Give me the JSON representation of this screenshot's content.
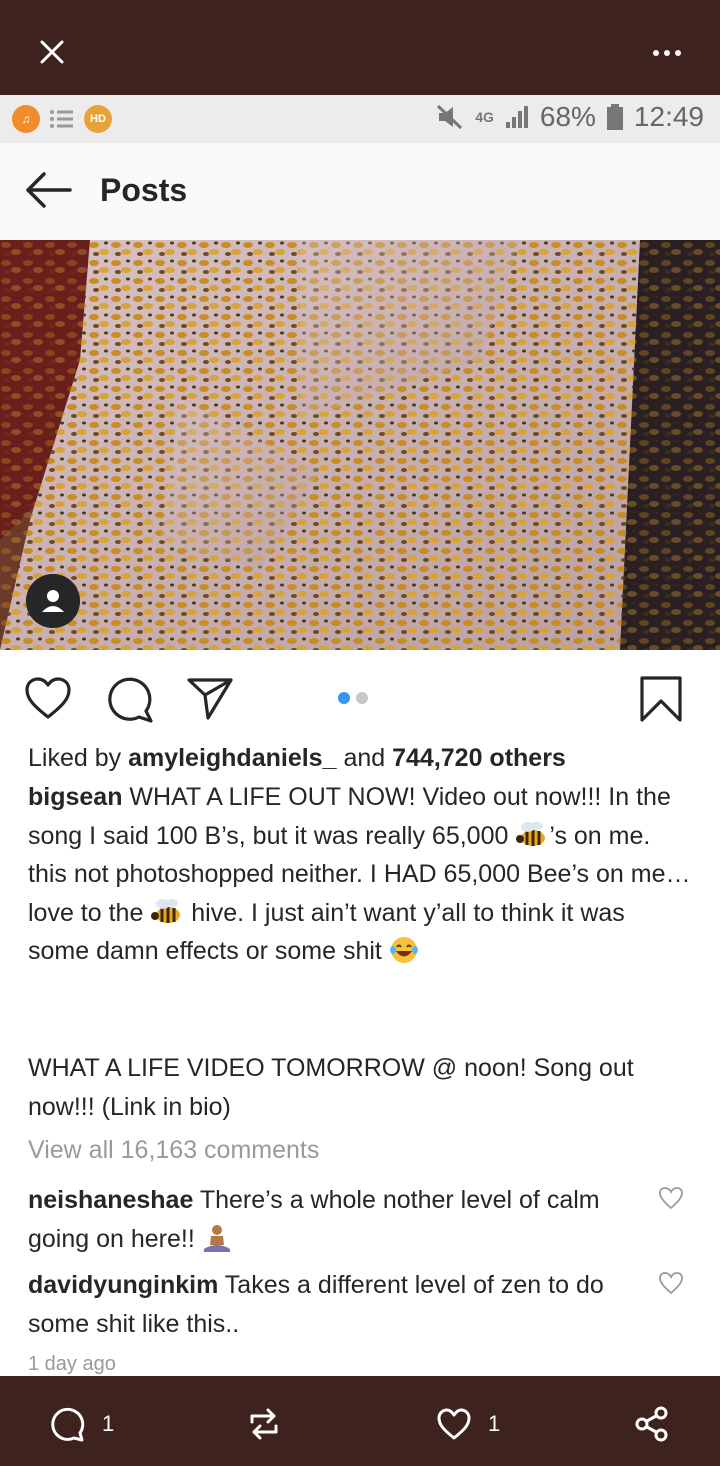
{
  "top_bar": {
    "close_icon": "close-icon",
    "more_icon": "more-icon"
  },
  "status_bar": {
    "left_icons": [
      "music-icon",
      "list-icon",
      "hd-icon"
    ],
    "hd_label": "HD",
    "network": "4G",
    "battery": "68%",
    "time": "12:49"
  },
  "header": {
    "title": "Posts"
  },
  "post": {
    "liked_prefix": "Liked by ",
    "liked_user": "amyleighdaniels_",
    "liked_and": " and ",
    "liked_count": "744,720 others",
    "author": "bigsean",
    "caption_parts": [
      " WHAT A LIFE OUT NOW! Video out now!!! In the song I said 100 B’s, but it was really 65,000 ",
      "’s on me. this not photoshopped neither. I HAD 65,000 Bee’s on me… love to the ",
      " hive. I just ain’t want y’all to think it was some damn effects or some shit "
    ],
    "caption_2": "WHAT A LIFE VIDEO TOMORROW @ noon! Song out now!!! (Link in bio)",
    "view_comments": "View all 16,163 comments",
    "comments": [
      {
        "user": "neishaneshae",
        "text": " There’s a whole nother level of calm going on here!! "
      },
      {
        "user": "davidyunginkim",
        "text": " Takes a different level of zen to do some shit like this.."
      }
    ],
    "timestamp": "1 day ago",
    "carousel": {
      "count": 2,
      "active": 1
    }
  },
  "bottom_bar": {
    "comment_count": "1",
    "like_count": "1"
  },
  "colors": {
    "bar": "#3e221e",
    "accent_blue": "#3897f0"
  }
}
